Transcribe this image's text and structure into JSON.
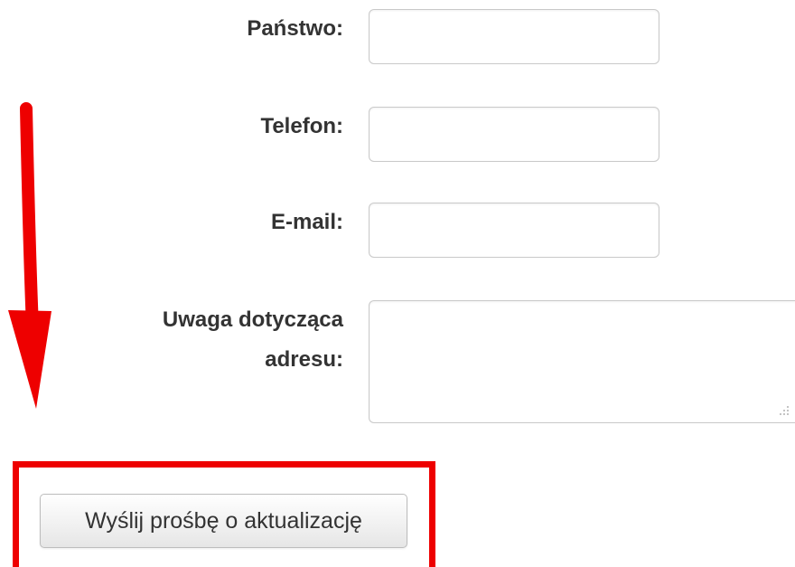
{
  "form": {
    "country_label": "Państwo:",
    "country_value": "",
    "phone_label": "Telefon:",
    "phone_value": "",
    "email_label": "E-mail:",
    "email_value": "",
    "address_note_label_line1": "Uwaga dotycząca",
    "address_note_label_line2": "adresu:",
    "address_note_value": "",
    "submit_label": "Wyślij prośbę o aktualizację"
  },
  "annotations": {
    "arrow_icon": "arrow-down-icon",
    "arrow_color": "#ee0000",
    "highlight_color": "#ee0000"
  }
}
